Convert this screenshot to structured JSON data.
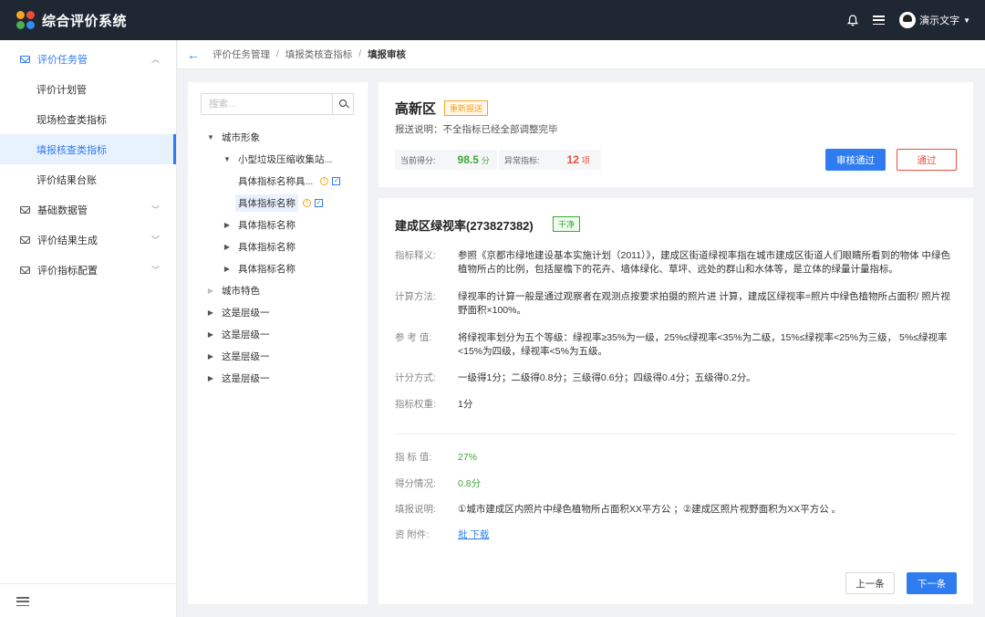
{
  "app": {
    "title": "综合评价系统",
    "user_name": "演示文字"
  },
  "sidebar": {
    "groups": [
      {
        "label": "评价任务管",
        "open": true,
        "items": [
          {
            "label": "评价计划管"
          },
          {
            "label": "现场检查类指标"
          },
          {
            "label": "填报核查类指标",
            "active": true
          },
          {
            "label": "评价结果台账"
          }
        ]
      },
      {
        "label": "基础数据管"
      },
      {
        "label": "评价结果生成"
      },
      {
        "label": "评价指标配置"
      }
    ]
  },
  "breadcrumb": [
    "评价任务管理",
    "填报类核查指标",
    "填报审核"
  ],
  "tree": {
    "search_placeholder": "搜索...",
    "nodes": [
      {
        "label": "城市形象"
      },
      {
        "label": "小型垃圾压缩收集站..."
      },
      {
        "label": "具体指标名称具..."
      },
      {
        "label": "具体指标名称"
      },
      {
        "label": "具体指标名称"
      },
      {
        "label": "具体指标名称"
      },
      {
        "label": "具体指标名称"
      },
      {
        "label": "城市特色"
      },
      {
        "label": "这是层级一"
      },
      {
        "label": "这是层级一"
      },
      {
        "label": "这是层级一"
      },
      {
        "label": "这是层级一"
      }
    ]
  },
  "summary": {
    "region": "高新区",
    "tag": "重新报送",
    "note_label": "报送说明：",
    "note": "不全指标已经全部调整完毕",
    "score_label": "当前得分:",
    "score": "98.5",
    "score_unit": "分",
    "abnormal_label": "异常指标:",
    "abnormal": "12",
    "abnormal_unit": "项",
    "approve_label": "审核通过",
    "pass_label": "通过"
  },
  "detail": {
    "title": "建成区绿视率(273827382)",
    "tag": "干净",
    "fields": [
      {
        "label": "指标释义:",
        "value": "参照《京都市绿地建设基本实施计划（2011）》，建成区街道绿视率指在城市建成区街道人们眼睛所看到的物体 中绿色植物所占的比例，包括屋檐下的花卉、墙体绿化、草坪、远处的群山和水体等，是立体的绿量计量指标。"
      },
      {
        "label": "计算方法:",
        "value": "绿视率的计算一般是通过观察者在观测点按要求拍摄的照片进   计算，建成区绿视率=照片中绿色植物所占面积/ 照片视野面积×100%。"
      },
      {
        "label": "参 考 值:",
        "value": "将绿视率划分为五个等级：绿视率≥35%为一级，25%≤绿视率<35%为二级，15%≤绿视率<25%为三级，  5%≤绿视率<15%为四级，绿视率<5%为五级。"
      },
      {
        "label": "计分方式:",
        "value": "一级得1分；二级得0.8分；三级得0.6分；四级得0.4分；五级得0.2分。"
      },
      {
        "label": "指标权重:",
        "value": "1分"
      },
      {
        "label": "指 标 值:",
        "value": "27%"
      },
      {
        "label": "得分情况:",
        "value": "0.8分"
      },
      {
        "label": "填报说明:",
        "value": "①城市建成区内照片中绿色植物所占面积XX平方公   ；②建成区照片视野面积为XX平方公    。"
      },
      {
        "label": "资   附件:",
        "value": "批   下载"
      }
    ],
    "prev_label": "上一条",
    "next_label": "下一条"
  },
  "colors": {
    "primary": "#2f7cf0",
    "topbar": "#1f2733",
    "success": "#3ca936",
    "danger": "#e94e3c",
    "warning": "#f5a623"
  }
}
